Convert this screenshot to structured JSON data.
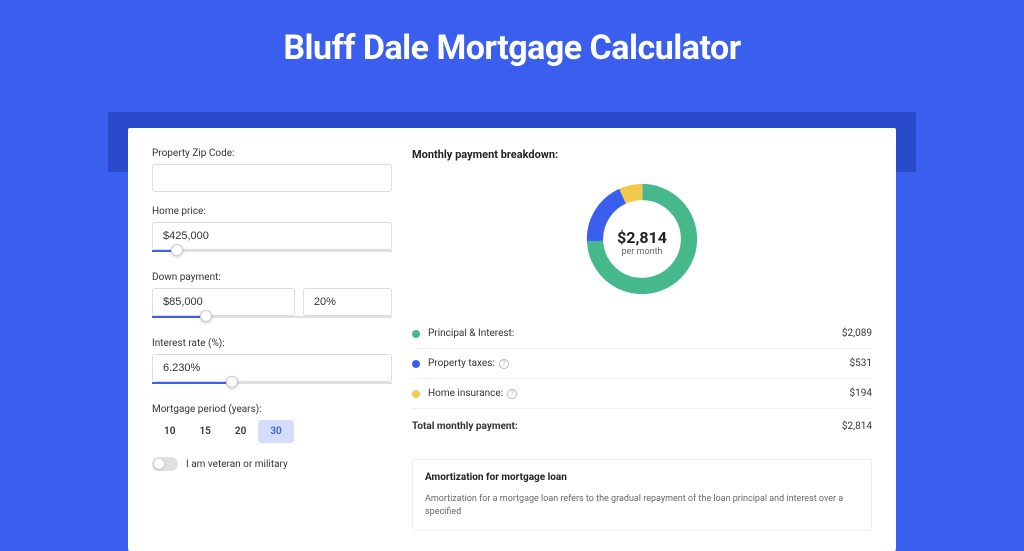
{
  "page_title": "Bluff Dale Mortgage Calculator",
  "form": {
    "zip_label": "Property Zip Code:",
    "zip_value": "",
    "home_price_label": "Home price:",
    "home_price_value": "$425,000",
    "home_price_slider_pct": 8,
    "down_label": "Down payment:",
    "down_value": "$85,000",
    "down_pct_value": "20%",
    "down_slider_pct": 20,
    "rate_label": "Interest rate (%):",
    "rate_value": "6.230%",
    "rate_slider_pct": 31,
    "period_label": "Mortgage period (years):",
    "period_options": [
      "10",
      "15",
      "20",
      "30"
    ],
    "period_selected": "30",
    "veteran_label": "I am veteran or military"
  },
  "breakdown": {
    "title": "Monthly payment breakdown:",
    "center_amount": "$2,814",
    "center_sub": "per month",
    "rows": [
      {
        "label": "Principal & Interest:",
        "value": "$2,089",
        "color": "#46b98c",
        "has_info": false
      },
      {
        "label": "Property taxes:",
        "value": "$531",
        "color": "#3a5fef",
        "has_info": true
      },
      {
        "label": "Home insurance:",
        "value": "$194",
        "color": "#f2c94c",
        "has_info": true
      }
    ],
    "total_label": "Total monthly payment:",
    "total_value": "$2,814"
  },
  "amortization": {
    "title": "Amortization for mortgage loan",
    "text": "Amortization for a mortgage loan refers to the gradual repayment of the loan principal and interest over a specified"
  },
  "chart_data": {
    "type": "pie",
    "title": "Monthly payment breakdown",
    "series": [
      {
        "name": "Principal & Interest",
        "value": 2089,
        "color": "#46b98c"
      },
      {
        "name": "Property taxes",
        "value": 531,
        "color": "#3a5fef"
      },
      {
        "name": "Home insurance",
        "value": 194,
        "color": "#f2c94c"
      }
    ],
    "total": 2814,
    "center_label": "$2,814 per month"
  }
}
